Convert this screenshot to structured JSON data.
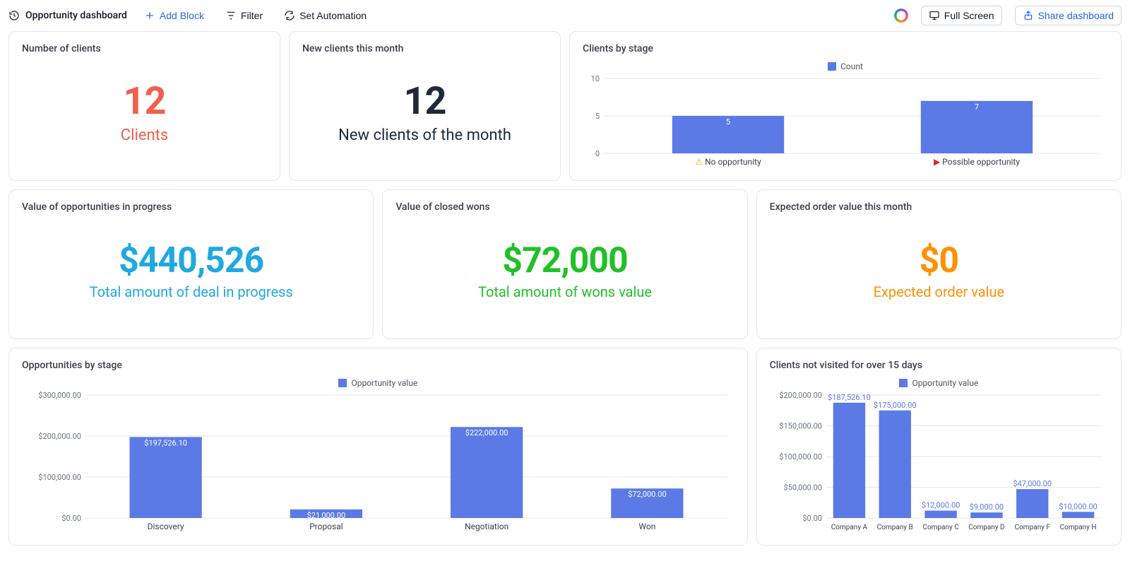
{
  "header": {
    "title": "Opportunity dashboard",
    "add_block": "Add Block",
    "filter": "Filter",
    "automation": "Set Automation",
    "full_screen": "Full Screen",
    "share": "Share dashboard"
  },
  "cards": {
    "num_clients": {
      "title": "Number of clients",
      "value": "12",
      "label": "Clients"
    },
    "new_clients": {
      "title": "New clients this month",
      "value": "12",
      "label": "New clients of the month"
    },
    "clients_by_stage": {
      "title": "Clients by stage",
      "legend": "Count"
    },
    "in_progress": {
      "title": "Value of opportunities in progress",
      "value": "$440,526",
      "label": "Total amount of deal in progress"
    },
    "closed_wons": {
      "title": "Value of closed wons",
      "value": "$72,000",
      "label": "Total amount of wons value"
    },
    "expected": {
      "title": "Expected order value this month",
      "value": "$0",
      "label": "Expected order value"
    },
    "opp_by_stage": {
      "title": "Opportunities by stage",
      "legend": "Opportunity value"
    },
    "not_visited": {
      "title": "Clients not visited for over 15 days",
      "legend": "Opportunity value"
    }
  },
  "chart_data": [
    {
      "id": "clients_by_stage",
      "type": "bar",
      "title": "Clients by stage",
      "legend": [
        "Count"
      ],
      "categories": [
        "No opportunity",
        "Possible opportunity"
      ],
      "category_icons": [
        "⚠",
        "▶"
      ],
      "category_icon_colors": [
        "#f59e0b",
        "#dc2626"
      ],
      "values": [
        5,
        7
      ],
      "value_labels": [
        "5",
        "7"
      ],
      "ylabel": "",
      "xlabel": "",
      "yticks": [
        0,
        5,
        10
      ],
      "ylim": [
        0,
        10
      ]
    },
    {
      "id": "opportunities_by_stage",
      "type": "bar",
      "title": "Opportunities by stage",
      "legend": [
        "Opportunity value"
      ],
      "categories": [
        "Discovery",
        "Proposal",
        "Negotiation",
        "Won"
      ],
      "values": [
        197526.1,
        21000.0,
        222000.0,
        72000.0
      ],
      "value_labels": [
        "$197,526.10",
        "$21,000.00",
        "$222,000.00",
        "$72,000.00"
      ],
      "ylabel": "",
      "xlabel": "",
      "yticks": [
        0,
        100000,
        200000,
        300000
      ],
      "ytick_labels": [
        "$0.00",
        "$100,000.00",
        "$200,000.00",
        "$300,000.00"
      ],
      "ylim": [
        0,
        300000
      ]
    },
    {
      "id": "clients_not_visited",
      "type": "bar",
      "title": "Clients not visited for over 15 days",
      "legend": [
        "Opportunity value"
      ],
      "categories": [
        "Company A",
        "Company B",
        "Company C",
        "Company D",
        "Company F",
        "Company H"
      ],
      "values": [
        187526.1,
        175000.0,
        12000.0,
        9000.0,
        47000.0,
        10000.0
      ],
      "value_labels": [
        "$187,526.10",
        "$175,000.00",
        "$12,000.00",
        "$9,000.00",
        "$47,000.00",
        "$10,000.00"
      ],
      "ylabel": "",
      "xlabel": "",
      "yticks": [
        0,
        50000,
        100000,
        150000,
        200000
      ],
      "ytick_labels": [
        "$0.00",
        "$50,000.00",
        "$100,000.00",
        "$150,000.00",
        "$200,000.00"
      ],
      "ylim": [
        0,
        200000
      ]
    }
  ]
}
